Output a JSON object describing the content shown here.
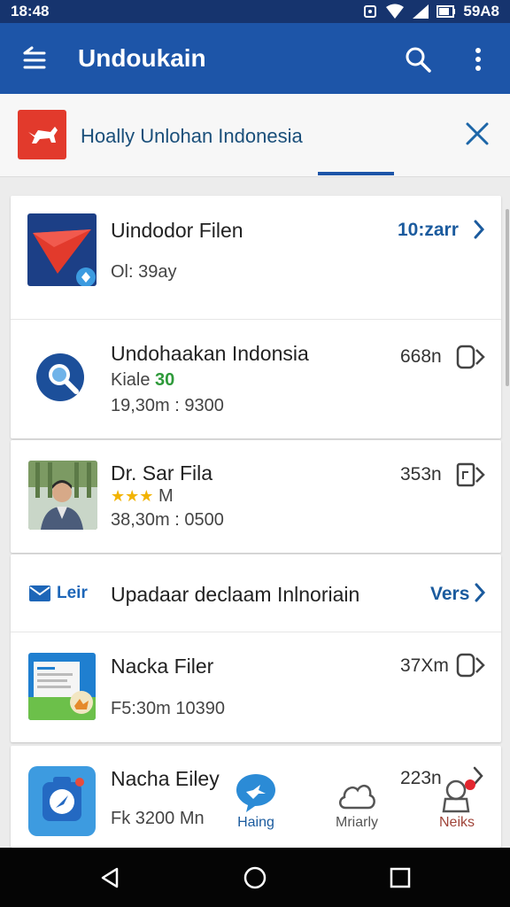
{
  "status_bar": {
    "time": "18:48",
    "right_text": "59A8"
  },
  "app_bar": {
    "title": "Undoukain"
  },
  "banner": {
    "text": "Hoally Unlohan Indonesia"
  },
  "items": [
    {
      "name": "Uindodor Filen",
      "sub": "Ol: 39ay",
      "size": "10:zarr"
    },
    {
      "name": "Undohaakan  Indonsia",
      "sub_a": "Kiale",
      "sub_b": "30",
      "sub2": "19,30m : 9300",
      "size": "668n"
    },
    {
      "name": "Dr. Sar Fila",
      "sub_a": "M",
      "sub2": "38,30m : 0500",
      "size": "353n"
    },
    {
      "tag": "Leir",
      "name": "Upadaar declaam Inlnoriain",
      "link": "Vers"
    },
    {
      "name": "Nacka Filer",
      "sub": "F5:30m 10390",
      "size": "37Xm"
    },
    {
      "name": "Nacha Eiley",
      "sub": "Fk 3200 Mn",
      "size": "223n"
    }
  ],
  "bottom_nav": [
    {
      "label": "Haing"
    },
    {
      "label": "Mriarly"
    },
    {
      "label": "Neiks"
    }
  ],
  "colors": {
    "primary": "#1d55a8",
    "status": "#16346e",
    "accent_red": "#e23a2c",
    "link": "#1b5b9e"
  }
}
